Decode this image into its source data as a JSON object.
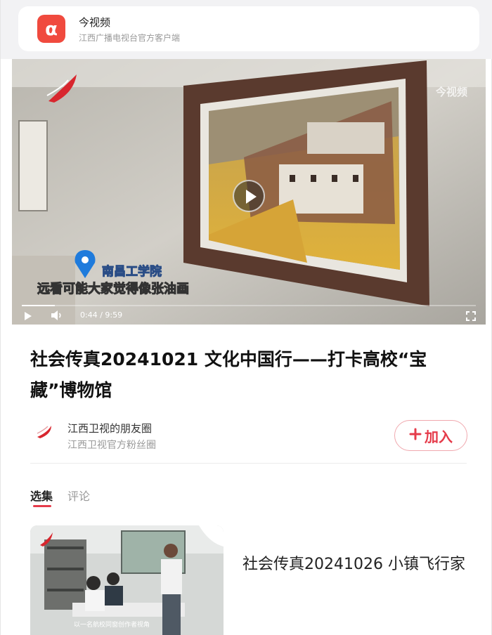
{
  "app": {
    "name": "今视频",
    "description": "江西广播电视台官方客户端"
  },
  "video": {
    "watermark": "今视频",
    "location_tag": "南昌工学院",
    "subtitle": "远看可能大家觉得像张油画",
    "time": "0:44 / 9:59",
    "progress": 0.073
  },
  "title": "社会传真20241021 文化中国行——打卡高校“宝藏”博物馆",
  "channel": {
    "name": "江西卫视的朋友圈",
    "description": "江西卫视官方粉丝圈",
    "join_label": "加入"
  },
  "tabs": {
    "episodes": "选集",
    "comments": "评论"
  },
  "episode": {
    "title": "社会传真20241026 小镇飞行家",
    "caption": "以一名航校同窗创作者视角"
  },
  "colors": {
    "brand": "#f04a3e",
    "accent": "#e53b4a"
  }
}
